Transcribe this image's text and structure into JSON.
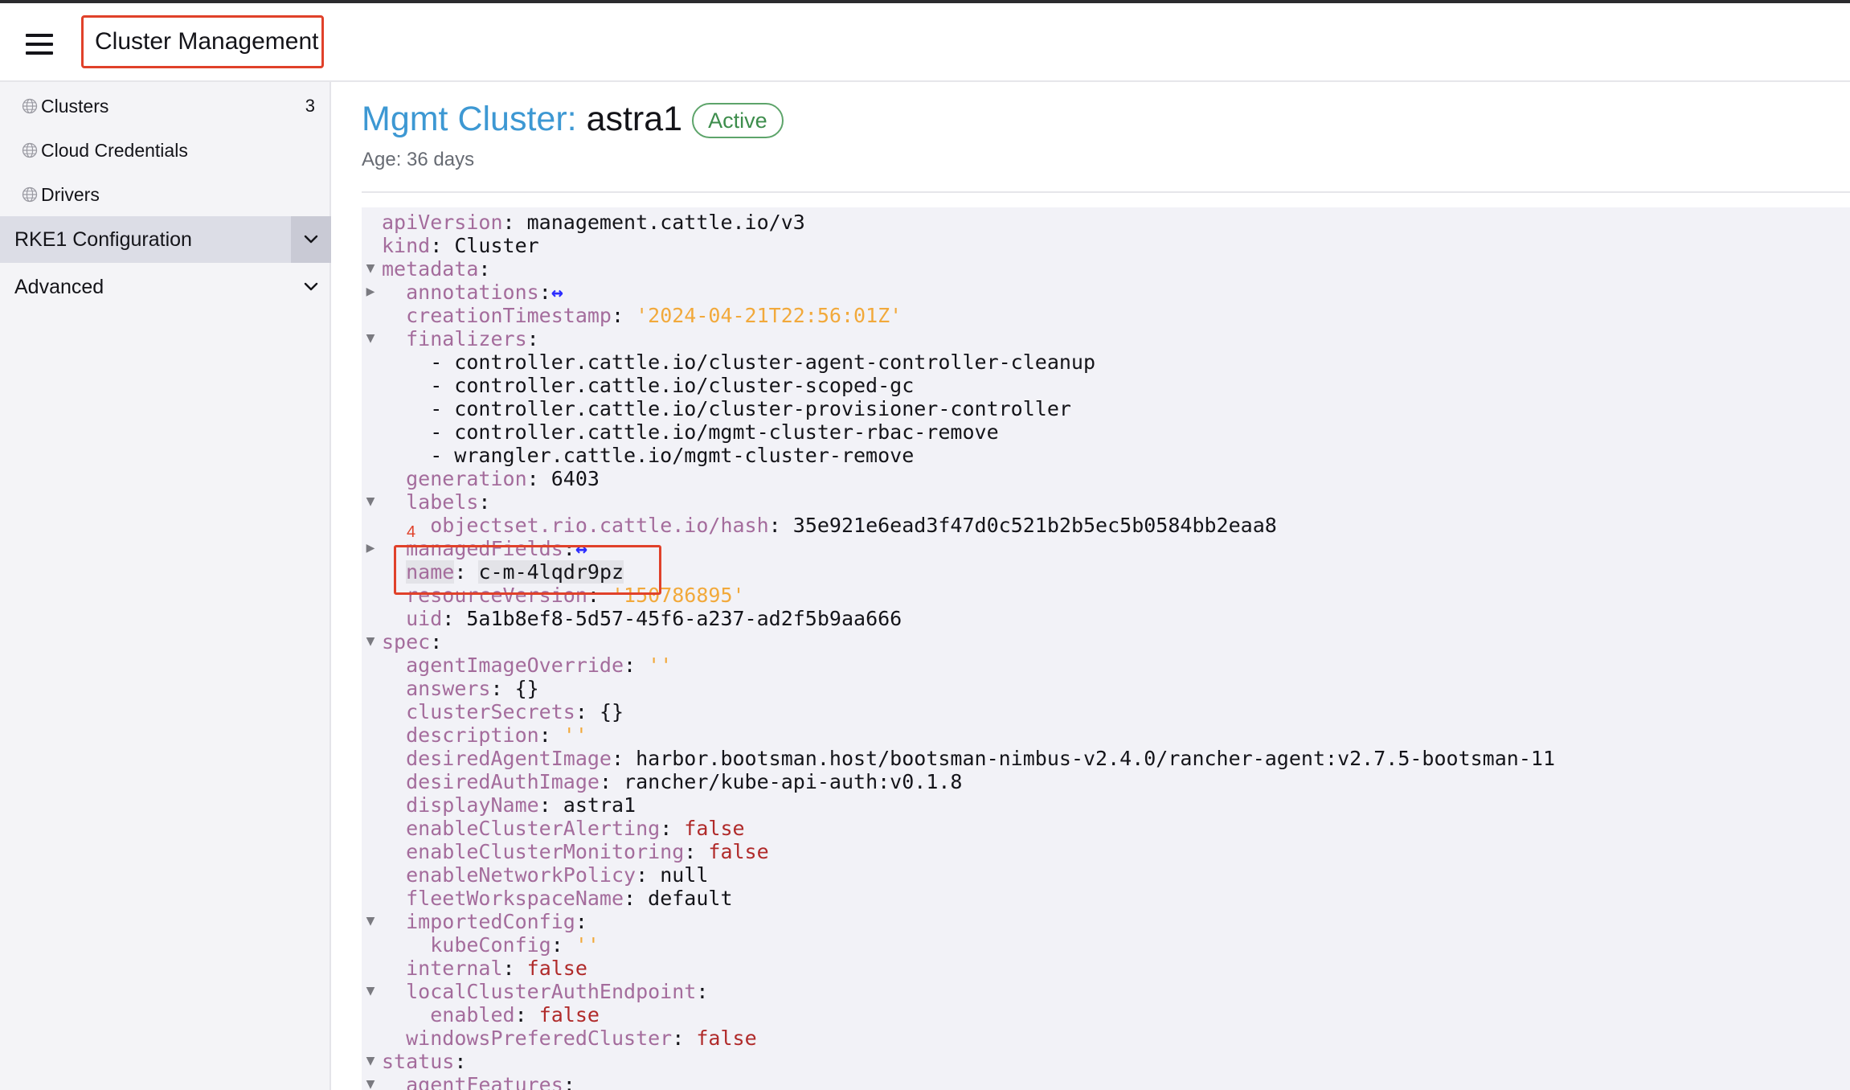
{
  "header": {
    "menu_icon": "hamburger-icon",
    "title": "Cluster Management"
  },
  "sidebar": {
    "items": [
      {
        "label": "Clusters",
        "count": "3",
        "icon": "globe-icon"
      },
      {
        "label": "Cloud Credentials",
        "icon": "globe-icon"
      },
      {
        "label": "Drivers",
        "icon": "globe-icon"
      }
    ],
    "groups": [
      {
        "label": "RKE1 Configuration",
        "icon": "chevron-down-icon",
        "active": true
      },
      {
        "label": "Advanced",
        "icon": "chevron-down-icon",
        "active": false
      }
    ]
  },
  "main": {
    "title_prefix": "Mgmt Cluster:",
    "title_name": "astra1",
    "status_badge": "Active",
    "age": "Age: 36 days"
  },
  "colors": {
    "accent_blue": "#3d98d3",
    "status_green": "#3d8d4c",
    "yaml_key": "#a46c9c",
    "yaml_string": "#f2a93b",
    "yaml_boolean": "#b02a2a",
    "annotation_red": "#e0412a"
  },
  "annotation": {
    "number": "4"
  },
  "yaml_lines": [
    {
      "fold": "",
      "content": [
        {
          "t": "k",
          "s": "apiVersion"
        },
        {
          "t": "p",
          "s": ": "
        },
        {
          "t": "v",
          "s": "management.cattle.io/v3"
        }
      ]
    },
    {
      "fold": "",
      "content": [
        {
          "t": "k",
          "s": "kind"
        },
        {
          "t": "p",
          "s": ": "
        },
        {
          "t": "v",
          "s": "Cluster"
        }
      ]
    },
    {
      "fold": "▼",
      "content": [
        {
          "t": "k",
          "s": "metadata"
        },
        {
          "t": "p",
          "s": ":"
        }
      ]
    },
    {
      "fold": "▶",
      "content": [
        {
          "t": "v",
          "s": "  "
        },
        {
          "t": "k",
          "s": "annotations"
        },
        {
          "t": "p",
          "s": ":"
        },
        {
          "t": "arrow",
          "s": "↔"
        }
      ]
    },
    {
      "fold": "",
      "content": [
        {
          "t": "v",
          "s": "  "
        },
        {
          "t": "k",
          "s": "creationTimestamp"
        },
        {
          "t": "p",
          "s": ": "
        },
        {
          "t": "str",
          "s": "'2024-04-21T22:56:01Z'"
        }
      ]
    },
    {
      "fold": "▼",
      "content": [
        {
          "t": "v",
          "s": "  "
        },
        {
          "t": "k",
          "s": "finalizers"
        },
        {
          "t": "p",
          "s": ":"
        }
      ]
    },
    {
      "fold": "",
      "content": [
        {
          "t": "v",
          "s": "    - controller.cattle.io/cluster-agent-controller-cleanup"
        }
      ]
    },
    {
      "fold": "",
      "content": [
        {
          "t": "v",
          "s": "    - controller.cattle.io/cluster-scoped-gc"
        }
      ]
    },
    {
      "fold": "",
      "content": [
        {
          "t": "v",
          "s": "    - controller.cattle.io/cluster-provisioner-controller"
        }
      ]
    },
    {
      "fold": "",
      "content": [
        {
          "t": "v",
          "s": "    - controller.cattle.io/mgmt-cluster-rbac-remove"
        }
      ]
    },
    {
      "fold": "",
      "content": [
        {
          "t": "v",
          "s": "    - wrangler.cattle.io/mgmt-cluster-remove"
        }
      ]
    },
    {
      "fold": "",
      "content": [
        {
          "t": "v",
          "s": "  "
        },
        {
          "t": "k",
          "s": "generation"
        },
        {
          "t": "p",
          "s": ": "
        },
        {
          "t": "v",
          "s": "6403"
        }
      ]
    },
    {
      "fold": "▼",
      "content": [
        {
          "t": "v",
          "s": "  "
        },
        {
          "t": "k",
          "s": "labels"
        },
        {
          "t": "p",
          "s": ":"
        }
      ]
    },
    {
      "fold": "",
      "content": [
        {
          "t": "v",
          "s": "    "
        },
        {
          "t": "k",
          "s": "objectset.rio.cattle.io/hash"
        },
        {
          "t": "p",
          "s": ": "
        },
        {
          "t": "v",
          "s": "35e921e6ead3f47d0c521b2b5ec5b0584bb2eaa8"
        }
      ]
    },
    {
      "fold": "▶",
      "content": [
        {
          "t": "v",
          "s": "  "
        },
        {
          "t": "k",
          "s": "managedFields"
        },
        {
          "t": "p",
          "s": ":"
        },
        {
          "t": "arrow",
          "s": "↔"
        }
      ]
    },
    {
      "fold": "",
      "content": [
        {
          "t": "v",
          "s": "  "
        },
        {
          "t": "k hl-bg",
          "s": "name"
        },
        {
          "t": "p",
          "s": ": "
        },
        {
          "t": "v hl-bg",
          "s": "c-m-4lqdr9pz"
        }
      ]
    },
    {
      "fold": "",
      "content": [
        {
          "t": "v",
          "s": "  "
        },
        {
          "t": "k",
          "s": "resourceVersion"
        },
        {
          "t": "p",
          "s": ": "
        },
        {
          "t": "str",
          "s": "'150786895'"
        }
      ]
    },
    {
      "fold": "",
      "content": [
        {
          "t": "v",
          "s": "  "
        },
        {
          "t": "k",
          "s": "uid"
        },
        {
          "t": "p",
          "s": ": "
        },
        {
          "t": "v",
          "s": "5a1b8ef8-5d57-45f6-a237-ad2f5b9aa666"
        }
      ]
    },
    {
      "fold": "▼",
      "content": [
        {
          "t": "k",
          "s": "spec"
        },
        {
          "t": "p",
          "s": ":"
        }
      ]
    },
    {
      "fold": "",
      "content": [
        {
          "t": "v",
          "s": "  "
        },
        {
          "t": "k",
          "s": "agentImageOverride"
        },
        {
          "t": "p",
          "s": ": "
        },
        {
          "t": "str",
          "s": "''"
        }
      ]
    },
    {
      "fold": "",
      "content": [
        {
          "t": "v",
          "s": "  "
        },
        {
          "t": "k",
          "s": "answers"
        },
        {
          "t": "p",
          "s": ": "
        },
        {
          "t": "v",
          "s": "{}"
        }
      ]
    },
    {
      "fold": "",
      "content": [
        {
          "t": "v",
          "s": "  "
        },
        {
          "t": "k",
          "s": "clusterSecrets"
        },
        {
          "t": "p",
          "s": ": "
        },
        {
          "t": "v",
          "s": "{}"
        }
      ]
    },
    {
      "fold": "",
      "content": [
        {
          "t": "v",
          "s": "  "
        },
        {
          "t": "k",
          "s": "description"
        },
        {
          "t": "p",
          "s": ": "
        },
        {
          "t": "str",
          "s": "''"
        }
      ]
    },
    {
      "fold": "",
      "content": [
        {
          "t": "v",
          "s": "  "
        },
        {
          "t": "k",
          "s": "desiredAgentImage"
        },
        {
          "t": "p",
          "s": ": "
        },
        {
          "t": "v",
          "s": "harbor.bootsman.host/bootsman-nimbus-v2.4.0/rancher-agent:v2.7.5-bootsman-11"
        }
      ]
    },
    {
      "fold": "",
      "content": [
        {
          "t": "v",
          "s": "  "
        },
        {
          "t": "k",
          "s": "desiredAuthImage"
        },
        {
          "t": "p",
          "s": ": "
        },
        {
          "t": "v",
          "s": "rancher/kube-api-auth:v0.1.8"
        }
      ]
    },
    {
      "fold": "",
      "content": [
        {
          "t": "v",
          "s": "  "
        },
        {
          "t": "k",
          "s": "displayName"
        },
        {
          "t": "p",
          "s": ": "
        },
        {
          "t": "v",
          "s": "astra1"
        }
      ]
    },
    {
      "fold": "",
      "content": [
        {
          "t": "v",
          "s": "  "
        },
        {
          "t": "k",
          "s": "enableClusterAlerting"
        },
        {
          "t": "p",
          "s": ": "
        },
        {
          "t": "bool",
          "s": "false"
        }
      ]
    },
    {
      "fold": "",
      "content": [
        {
          "t": "v",
          "s": "  "
        },
        {
          "t": "k",
          "s": "enableClusterMonitoring"
        },
        {
          "t": "p",
          "s": ": "
        },
        {
          "t": "bool",
          "s": "false"
        }
      ]
    },
    {
      "fold": "",
      "content": [
        {
          "t": "v",
          "s": "  "
        },
        {
          "t": "k",
          "s": "enableNetworkPolicy"
        },
        {
          "t": "p",
          "s": ": "
        },
        {
          "t": "v",
          "s": "null"
        }
      ]
    },
    {
      "fold": "",
      "content": [
        {
          "t": "v",
          "s": "  "
        },
        {
          "t": "k",
          "s": "fleetWorkspaceName"
        },
        {
          "t": "p",
          "s": ": "
        },
        {
          "t": "v",
          "s": "default"
        }
      ]
    },
    {
      "fold": "▼",
      "content": [
        {
          "t": "v",
          "s": "  "
        },
        {
          "t": "k",
          "s": "importedConfig"
        },
        {
          "t": "p",
          "s": ":"
        }
      ]
    },
    {
      "fold": "",
      "content": [
        {
          "t": "v",
          "s": "    "
        },
        {
          "t": "k",
          "s": "kubeConfig"
        },
        {
          "t": "p",
          "s": ": "
        },
        {
          "t": "str",
          "s": "''"
        }
      ]
    },
    {
      "fold": "",
      "content": [
        {
          "t": "v",
          "s": "  "
        },
        {
          "t": "k",
          "s": "internal"
        },
        {
          "t": "p",
          "s": ": "
        },
        {
          "t": "bool",
          "s": "false"
        }
      ]
    },
    {
      "fold": "▼",
      "content": [
        {
          "t": "v",
          "s": "  "
        },
        {
          "t": "k",
          "s": "localClusterAuthEndpoint"
        },
        {
          "t": "p",
          "s": ":"
        }
      ]
    },
    {
      "fold": "",
      "content": [
        {
          "t": "v",
          "s": "    "
        },
        {
          "t": "k",
          "s": "enabled"
        },
        {
          "t": "p",
          "s": ": "
        },
        {
          "t": "bool",
          "s": "false"
        }
      ]
    },
    {
      "fold": "",
      "content": [
        {
          "t": "v",
          "s": "  "
        },
        {
          "t": "k",
          "s": "windowsPreferedCluster"
        },
        {
          "t": "p",
          "s": ": "
        },
        {
          "t": "bool",
          "s": "false"
        }
      ]
    },
    {
      "fold": "▼",
      "content": [
        {
          "t": "k",
          "s": "status"
        },
        {
          "t": "p",
          "s": ":"
        }
      ]
    },
    {
      "fold": "▼",
      "content": [
        {
          "t": "v",
          "s": "  "
        },
        {
          "t": "k",
          "s": "agentFeatures"
        },
        {
          "t": "p",
          "s": ":"
        }
      ]
    }
  ]
}
